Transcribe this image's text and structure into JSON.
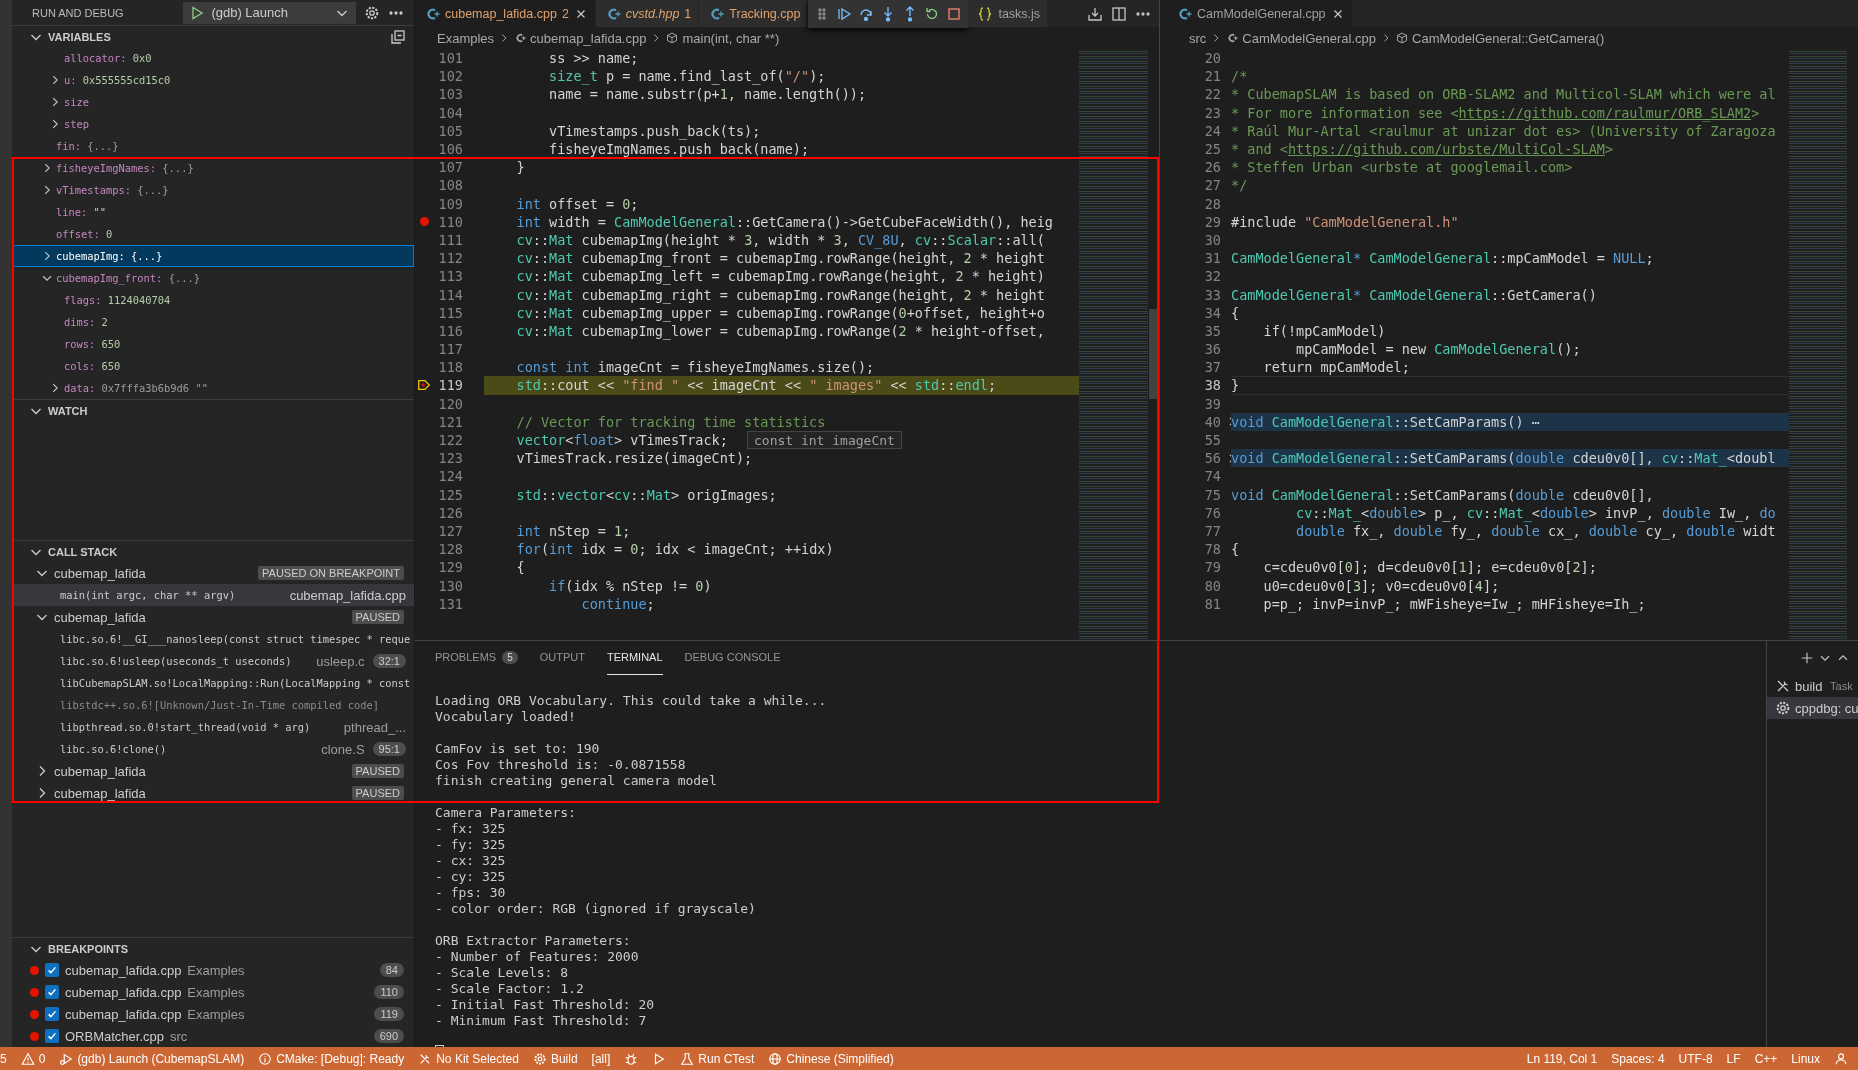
{
  "sidebar": {
    "title": "RUN AND DEBUG",
    "launch_config": "(gdb) Launch",
    "variables": {
      "title": "VARIABLES",
      "items": [
        {
          "children": [
            {
              "name": "allocator:",
              "value": "0x0",
              "kind": "number",
              "selected": false
            },
            {
              "name": "u:",
              "value": "0x555555cd15c0",
              "kind": "number",
              "expanded": false,
              "selected": false
            },
            {
              "name": "size",
              "expanded": false,
              "selected": false
            },
            {
              "name": "step",
              "expanded": false,
              "selected": false
            }
          ]
        },
        {
          "name": "fin:",
          "value": "{...}",
          "kind": "preview",
          "selected": false
        },
        {
          "name": "fisheyeImgNames:",
          "value": "{...}",
          "kind": "preview",
          "expanded": false,
          "selected": false
        },
        {
          "name": "vTimestamps:",
          "value": "{...}",
          "kind": "preview",
          "expanded": false,
          "selected": false
        },
        {
          "name": "line:",
          "value": "\"\"",
          "kind": "string",
          "selected": false
        },
        {
          "name": "offset:",
          "value": "0",
          "kind": "number",
          "selected": false
        },
        {
          "name": "cubemapImg:",
          "value": "{...}",
          "kind": "preview",
          "expanded": false,
          "selected": true
        },
        {
          "name": "cubemapImg_front:",
          "value": "{...}",
          "kind": "preview",
          "expanded": true,
          "selected": false,
          "children": [
            {
              "name": "flags:",
              "value": "1124040704",
              "kind": "number",
              "selected": false
            },
            {
              "name": "dims:",
              "value": "2",
              "kind": "number",
              "selected": false
            },
            {
              "name": "rows:",
              "value": "650",
              "kind": "number",
              "selected": false
            },
            {
              "name": "cols:",
              "value": "650",
              "kind": "number",
              "selected": false
            },
            {
              "name": "data:",
              "value": "0x7fffa3b6b9d6 \"\"",
              "kind": "preview",
              "expanded": false,
              "selected": false
            }
          ]
        }
      ]
    },
    "watch": {
      "title": "WATCH"
    },
    "call_stack": {
      "title": "CALL STACK",
      "threads": [
        {
          "name": "cubemap_lafida",
          "status": "PAUSED ON BREAKPOINT",
          "expanded": true,
          "frames": [
            {
              "label": "main(int argc, char ** argv)",
              "file": "cubemap_lafida.cpp",
              "subtle": false,
              "selected": true
            }
          ]
        },
        {
          "name": "cubemap_lafida",
          "status": "PAUSED",
          "expanded": true,
          "frames": [
            {
              "label": "libc.so.6!__GI___nanosleep(const struct timespec * reque",
              "subtle": false,
              "selected": false
            },
            {
              "label": "libc.so.6!usleep(useconds_t useconds)",
              "file": "usleep.c",
              "position": "32:1",
              "subtle": false,
              "selected": false
            },
            {
              "label": "libCubemapSLAM.so!LocalMapping::Run(LocalMapping * const",
              "subtle": false,
              "selected": false
            },
            {
              "label": "libstdc++.so.6![Unknown/Just-In-Time compiled code]",
              "subtle": true,
              "selected": false
            },
            {
              "label": "libpthread.so.0!start_thread(void * arg)",
              "file": "pthread_...",
              "subtle": false,
              "selected": false
            },
            {
              "label": "libc.so.6!clone()",
              "file": "clone.S",
              "position": "95:1",
              "subtle": false,
              "selected": false
            }
          ]
        },
        {
          "name": "cubemap_lafida",
          "status": "PAUSED",
          "expanded": false
        },
        {
          "name": "cubemap_lafida",
          "status": "PAUSED",
          "expanded": false
        }
      ]
    },
    "breakpoints": {
      "title": "BREAKPOINTS",
      "items": [
        {
          "file": "cubemap_lafida.cpp",
          "folder": "Examples",
          "line": "84",
          "checked": true
        },
        {
          "file": "cubemap_lafida.cpp",
          "folder": "Examples",
          "line": "110",
          "checked": true
        },
        {
          "file": "cubemap_lafida.cpp",
          "folder": "Examples",
          "line": "119",
          "checked": true
        },
        {
          "file": "ORBMatcher.cpp",
          "folder": "src",
          "line": "690",
          "checked": true
        }
      ]
    }
  },
  "editor_left": {
    "tabs": [
      {
        "label": "cubemap_lafida.cpp",
        "badge": "2",
        "kind": "cpp",
        "selected": true,
        "italic": false,
        "has_problems": true
      },
      {
        "label": "cvstd.hpp",
        "badge": "1",
        "kind": "cpp",
        "selected": false,
        "italic": true,
        "has_problems": true
      },
      {
        "label": "Tracking.cpp",
        "kind": "cpp",
        "selected": false,
        "italic": false,
        "has_problems": true
      },
      {
        "label": "tasks.js",
        "kind": "json",
        "selected": false,
        "italic": false,
        "has_problems": false
      }
    ],
    "breadcrumbs": {
      "folder": "Examples",
      "file": "cubemap_lafida.cpp",
      "symbol": "main(int, char **)"
    },
    "hover": "const int imageCnt",
    "lines": [
      {
        "n": "101",
        "tokens": [
          {
            "text": "        ss >> name;"
          }
        ]
      },
      {
        "n": "102",
        "tokens": [
          {
            "text": "        size_t",
            "kind": "type"
          },
          {
            "text": " p = name.find_last_of("
          },
          {
            "text": "\"/\"",
            "kind": "string"
          },
          {
            "text": ");"
          }
        ]
      },
      {
        "n": "103",
        "tokens": [
          {
            "text": "        name = name.substr(p+"
          },
          {
            "text": "1",
            "kind": "number"
          },
          {
            "text": ", name.length());"
          }
        ]
      },
      {
        "n": "104"
      },
      {
        "n": "105",
        "tokens": [
          {
            "text": "        vTimestamps.push_back(ts);"
          }
        ]
      },
      {
        "n": "106",
        "tokens": [
          {
            "text": "        fisheyeImgNames.push_back(name);"
          }
        ]
      },
      {
        "n": "107",
        "tokens": [
          {
            "text": "    }"
          }
        ]
      },
      {
        "n": "108"
      },
      {
        "n": "109",
        "tokens": [
          {
            "text": "    int",
            "kind": "keyword"
          },
          {
            "text": " offset = "
          },
          {
            "text": "0",
            "kind": "number"
          },
          {
            "text": ";"
          }
        ]
      },
      {
        "n": "110",
        "kind": "breakpoint",
        "tokens": [
          {
            "text": "    int",
            "kind": "keyword"
          },
          {
            "text": " width = "
          },
          {
            "text": "CamModelGeneral",
            "kind": "type"
          },
          {
            "text": "::GetCamera()->GetCubeFaceWidth(), heig"
          }
        ]
      },
      {
        "n": "111",
        "tokens": [
          {
            "text": "    cv",
            "kind": "type"
          },
          {
            "text": "::"
          },
          {
            "text": "Mat",
            "kind": "type"
          },
          {
            "text": " cubemapImg(height * "
          },
          {
            "text": "3",
            "kind": "number"
          },
          {
            "text": ", width * "
          },
          {
            "text": "3",
            "kind": "number"
          },
          {
            "text": ", "
          },
          {
            "text": "CV_8U",
            "kind": "keyword"
          },
          {
            "text": ", "
          },
          {
            "text": "cv",
            "kind": "type"
          },
          {
            "text": "::"
          },
          {
            "text": "Scalar",
            "kind": "type"
          },
          {
            "text": "::all("
          }
        ]
      },
      {
        "n": "112",
        "tokens": [
          {
            "text": "    cv",
            "kind": "type"
          },
          {
            "text": "::"
          },
          {
            "text": "Mat",
            "kind": "type"
          },
          {
            "text": " cubemapImg_front = cubemapImg.rowRange(height, "
          },
          {
            "text": "2",
            "kind": "number"
          },
          {
            "text": " * height"
          }
        ]
      },
      {
        "n": "113",
        "tokens": [
          {
            "text": "    cv",
            "kind": "type"
          },
          {
            "text": "::"
          },
          {
            "text": "Mat",
            "kind": "type"
          },
          {
            "text": " cubemapImg_left = cubemapImg.rowRange(height, "
          },
          {
            "text": "2",
            "kind": "number"
          },
          {
            "text": " * height)"
          }
        ]
      },
      {
        "n": "114",
        "tokens": [
          {
            "text": "    cv",
            "kind": "type"
          },
          {
            "text": "::"
          },
          {
            "text": "Mat",
            "kind": "type"
          },
          {
            "text": " cubemapImg_right = cubemapImg.rowRange(height, "
          },
          {
            "text": "2",
            "kind": "number"
          },
          {
            "text": " * height"
          }
        ]
      },
      {
        "n": "115",
        "tokens": [
          {
            "text": "    cv",
            "kind": "type"
          },
          {
            "text": "::"
          },
          {
            "text": "Mat",
            "kind": "type"
          },
          {
            "text": " cubemapImg_upper = cubemapImg.rowRange("
          },
          {
            "text": "0",
            "kind": "number"
          },
          {
            "text": "+offset, height+o"
          }
        ]
      },
      {
        "n": "116",
        "tokens": [
          {
            "text": "    cv",
            "kind": "type"
          },
          {
            "text": "::"
          },
          {
            "text": "Mat",
            "kind": "type"
          },
          {
            "text": " cubemapImg_lower = cubemapImg.rowRange("
          },
          {
            "text": "2",
            "kind": "number"
          },
          {
            "text": " * height-offset,"
          }
        ]
      },
      {
        "n": "117"
      },
      {
        "n": "118",
        "tokens": [
          {
            "text": "    const",
            "kind": "keyword"
          },
          {
            "text": " int",
            "kind": "keyword"
          },
          {
            "text": " imageCnt = fisheyeImgNames.size();"
          }
        ]
      },
      {
        "n": "119",
        "kind": "current",
        "tokens": [
          {
            "text": "    std",
            "kind": "type"
          },
          {
            "text": "::cout << "
          },
          {
            "text": "\"find \"",
            "kind": "string"
          },
          {
            "text": " << imageCnt << "
          },
          {
            "text": "\" images\"",
            "kind": "string"
          },
          {
            "text": " << "
          },
          {
            "text": "std",
            "kind": "type"
          },
          {
            "text": "::"
          },
          {
            "text": "endl",
            "kind": "type"
          },
          {
            "text": ";"
          }
        ]
      },
      {
        "n": "120"
      },
      {
        "n": "121",
        "tokens": [
          {
            "text": "    // Vector for tracking time statistics",
            "kind": "comment"
          }
        ]
      },
      {
        "n": "122",
        "tokens": [
          {
            "text": "    vector",
            "kind": "type"
          },
          {
            "text": "<"
          },
          {
            "text": "float",
            "kind": "keyword"
          },
          {
            "text": "> vTimesTrack;"
          }
        ]
      },
      {
        "n": "123",
        "tokens": [
          {
            "text": "    vTimesTrack.resize(imageCnt);"
          }
        ]
      },
      {
        "n": "124"
      },
      {
        "n": "125",
        "tokens": [
          {
            "text": "    std",
            "kind": "type"
          },
          {
            "text": "::"
          },
          {
            "text": "vector",
            "kind": "type"
          },
          {
            "text": "<"
          },
          {
            "text": "cv",
            "kind": "type"
          },
          {
            "text": "::"
          },
          {
            "text": "Mat",
            "kind": "type"
          },
          {
            "text": "> origImages;"
          }
        ]
      },
      {
        "n": "126"
      },
      {
        "n": "127",
        "tokens": [
          {
            "text": "    int",
            "kind": "keyword"
          },
          {
            "text": " nStep = "
          },
          {
            "text": "1",
            "kind": "number"
          },
          {
            "text": ";"
          }
        ]
      },
      {
        "n": "128",
        "tokens": [
          {
            "text": "    for",
            "kind": "keyword"
          },
          {
            "text": "("
          },
          {
            "text": "int",
            "kind": "keyword"
          },
          {
            "text": " idx = "
          },
          {
            "text": "0",
            "kind": "number"
          },
          {
            "text": "; idx < imageCnt; ++idx)"
          }
        ]
      },
      {
        "n": "129",
        "tokens": [
          {
            "text": "    {"
          }
        ]
      },
      {
        "n": "130",
        "tokens": [
          {
            "text": "        if",
            "kind": "keyword"
          },
          {
            "text": "(idx % nStep != "
          },
          {
            "text": "0",
            "kind": "number"
          },
          {
            "text": ")"
          }
        ]
      },
      {
        "n": "131",
        "tokens": [
          {
            "text": "            continue",
            "kind": "keyword"
          },
          {
            "text": ";"
          }
        ]
      }
    ]
  },
  "editor_right": {
    "tabs": [
      {
        "label": "CamModelGeneral.cpp",
        "kind": "cpp",
        "selected": true,
        "italic": false,
        "has_problems": false
      }
    ],
    "breadcrumbs": {
      "folder": "src",
      "file": "CamModelGeneral.cpp",
      "symbol": "CamModelGeneral::GetCamera()"
    },
    "lines": [
      {
        "n": "20"
      },
      {
        "n": "21",
        "tokens": [
          {
            "text": "/*",
            "kind": "comment"
          }
        ]
      },
      {
        "n": "22",
        "tokens": [
          {
            "text": "* CubemapSLAM is based on ORB-SLAM2 and Multicol-SLAM which were al",
            "kind": "comment"
          }
        ]
      },
      {
        "n": "23",
        "tokens": [
          {
            "text": "* For more information see <",
            "kind": "comment"
          },
          {
            "text": "https://github.com/raulmur/ORB_SLAM2",
            "kind": "link"
          },
          {
            "text": ">",
            "kind": "comment"
          }
        ]
      },
      {
        "n": "24",
        "tokens": [
          {
            "text": "* Raúl Mur-Artal <raulmur at unizar dot es> (University of Zaragoza",
            "kind": "comment"
          }
        ]
      },
      {
        "n": "25",
        "tokens": [
          {
            "text": "* and <",
            "kind": "comment"
          },
          {
            "text": "https://github.com/urbste/MultiCol-SLAM",
            "kind": "link"
          },
          {
            "text": ">",
            "kind": "comment"
          }
        ]
      },
      {
        "n": "26",
        "tokens": [
          {
            "text": "* Steffen Urban <urbste at googlemail.com>",
            "kind": "comment"
          }
        ]
      },
      {
        "n": "27",
        "tokens": [
          {
            "text": "*/",
            "kind": "comment"
          }
        ]
      },
      {
        "n": "28"
      },
      {
        "n": "29",
        "tokens": [
          {
            "text": "#include "
          },
          {
            "text": "\"CamModelGeneral.h\"",
            "kind": "string"
          }
        ]
      },
      {
        "n": "30"
      },
      {
        "n": "31",
        "tokens": [
          {
            "text": "CamModelGeneral",
            "kind": "type"
          },
          {
            "text": "* ",
            "kind": "keyword"
          },
          {
            "text": "CamModelGeneral",
            "kind": "type"
          },
          {
            "text": "::mpCamModel = "
          },
          {
            "text": "NULL",
            "kind": "keyword"
          },
          {
            "text": ";"
          }
        ]
      },
      {
        "n": "32"
      },
      {
        "n": "33",
        "tokens": [
          {
            "text": "CamModelGeneral",
            "kind": "type"
          },
          {
            "text": "* ",
            "kind": "keyword"
          },
          {
            "text": "CamModelGeneral",
            "kind": "type"
          },
          {
            "text": "::GetCamera()"
          }
        ]
      },
      {
        "n": "34",
        "tokens": [
          {
            "text": "{"
          }
        ]
      },
      {
        "n": "35",
        "tokens": [
          {
            "text": "    if(!mpCamModel)"
          }
        ]
      },
      {
        "n": "36",
        "tokens": [
          {
            "text": "        mpCamModel = new "
          },
          {
            "text": "CamModelGeneral",
            "kind": "type"
          },
          {
            "text": "();"
          }
        ]
      },
      {
        "n": "37",
        "tokens": [
          {
            "text": "    return mpCamModel;"
          }
        ]
      },
      {
        "n": "38",
        "kind": "cursor",
        "tokens": [
          {
            "text": "}"
          }
        ]
      },
      {
        "n": "39"
      },
      {
        "n": "40",
        "kind": "folded",
        "tokens": [
          {
            "text": "void",
            "kind": "keyword"
          },
          {
            "text": " CamModelGeneral",
            "kind": "type"
          },
          {
            "text": "::SetCamParams() ⋯"
          }
        ]
      },
      {
        "n": "55"
      },
      {
        "n": "56",
        "kind": "folded",
        "tokens": [
          {
            "text": "void",
            "kind": "keyword"
          },
          {
            "text": " CamModelGeneral",
            "kind": "type"
          },
          {
            "text": "::SetCamParams("
          },
          {
            "text": "double",
            "kind": "keyword"
          },
          {
            "text": " cdeu0v0[], "
          },
          {
            "text": "cv",
            "kind": "type"
          },
          {
            "text": "::"
          },
          {
            "text": "Mat_",
            "kind": "type"
          },
          {
            "text": "<doubl"
          }
        ]
      },
      {
        "n": "74"
      },
      {
        "n": "75",
        "tokens": [
          {
            "text": "void",
            "kind": "keyword"
          },
          {
            "text": " CamModelGeneral",
            "kind": "type"
          },
          {
            "text": "::SetCamParams("
          },
          {
            "text": "double",
            "kind": "keyword"
          },
          {
            "text": " cdeu0v0[],"
          }
        ]
      },
      {
        "n": "76",
        "tokens": [
          {
            "text": "        cv",
            "kind": "type"
          },
          {
            "text": "::"
          },
          {
            "text": "Mat_",
            "kind": "type"
          },
          {
            "text": "<"
          },
          {
            "text": "double",
            "kind": "keyword"
          },
          {
            "text": "> p_, "
          },
          {
            "text": "cv",
            "kind": "type"
          },
          {
            "text": "::"
          },
          {
            "text": "Mat_",
            "kind": "type"
          },
          {
            "text": "<"
          },
          {
            "text": "double",
            "kind": "keyword"
          },
          {
            "text": "> invP_, "
          },
          {
            "text": "double",
            "kind": "keyword"
          },
          {
            "text": " Iw_, "
          },
          {
            "text": "do",
            "kind": "keyword"
          }
        ]
      },
      {
        "n": "77",
        "tokens": [
          {
            "text": "        double",
            "kind": "keyword"
          },
          {
            "text": " fx_, "
          },
          {
            "text": "double",
            "kind": "keyword"
          },
          {
            "text": " fy_, "
          },
          {
            "text": "double",
            "kind": "keyword"
          },
          {
            "text": " cx_, "
          },
          {
            "text": "double",
            "kind": "keyword"
          },
          {
            "text": " cy_, "
          },
          {
            "text": "double",
            "kind": "keyword"
          },
          {
            "text": " widt"
          }
        ]
      },
      {
        "n": "78",
        "tokens": [
          {
            "text": "{"
          }
        ]
      },
      {
        "n": "79",
        "tokens": [
          {
            "text": "    c=cdeu0v0["
          },
          {
            "text": "0",
            "kind": "number"
          },
          {
            "text": "]; d=cdeu0v0["
          },
          {
            "text": "1",
            "kind": "number"
          },
          {
            "text": "]; e=cdeu0v0["
          },
          {
            "text": "2",
            "kind": "number"
          },
          {
            "text": "];"
          }
        ]
      },
      {
        "n": "80",
        "tokens": [
          {
            "text": "    u0=cdeu0v0["
          },
          {
            "text": "3",
            "kind": "number"
          },
          {
            "text": "]; v0=cdeu0v0["
          },
          {
            "text": "4",
            "kind": "number"
          },
          {
            "text": "];"
          }
        ]
      },
      {
        "n": "81",
        "tokens": [
          {
            "text": "    p=p_; invP=invP_; mWFisheye=Iw_; mHFisheye=Ih_;"
          }
        ]
      }
    ]
  },
  "panel": {
    "tabs": [
      {
        "label": "PROBLEMS",
        "badge": "5",
        "selected": false
      },
      {
        "label": "OUTPUT",
        "selected": false
      },
      {
        "label": "TERMINAL",
        "selected": true
      },
      {
        "label": "DEBUG CONSOLE",
        "selected": false
      }
    ],
    "terminal_blocks": [
      [
        "Loading ORB Vocabulary. This could take a while...",
        "Vocabulary loaded!"
      ],
      [
        "CamFov is set to: 190",
        "Cos Fov threshold is: -0.0871558",
        "finish creating general camera model"
      ],
      [
        "Camera Parameters:",
        "- fx: 325",
        "- fy: 325",
        "- cx: 325",
        "- cy: 325",
        "- fps: 30",
        "- color order: RGB (ignored if grayscale)"
      ],
      [
        "ORB Extractor Parameters:",
        "- Number of Features: 2000",
        "- Scale Levels: 8",
        "- Scale Factor: 1.2",
        "- Initial Fast Threshold: 20",
        "- Minimum Fast Threshold: 7"
      ]
    ],
    "terminals": [
      {
        "label": "build",
        "detail": "Task",
        "kind": "task",
        "selected": false
      },
      {
        "label": "cppdbg: cu",
        "kind": "debug",
        "selected": true
      }
    ]
  },
  "status_bar": {
    "left": [
      {
        "text": "5"
      },
      {
        "kind": "warning",
        "text": "0"
      },
      {
        "kind": "debug",
        "text": "(gdb) Launch (CubemapSLAM)"
      },
      {
        "kind": "info",
        "text": "CMake: [Debug]: Ready"
      },
      {
        "kind": "tools",
        "text": "No Kit Selected"
      },
      {
        "kind": "gear",
        "text": "Build"
      },
      {
        "text": "[all]"
      },
      {
        "kind": "bug"
      },
      {
        "kind": "play"
      },
      {
        "kind": "flask",
        "text": "Run CTest"
      },
      {
        "kind": "globe",
        "text": "Chinese (Simplified)"
      }
    ],
    "right": [
      {
        "text": "Ln 119, Col 1"
      },
      {
        "text": "Spaces: 4"
      },
      {
        "text": "UTF-8"
      },
      {
        "text": "LF"
      },
      {
        "text": "C++"
      },
      {
        "text": "Linux"
      },
      {
        "kind": "person"
      }
    ]
  }
}
